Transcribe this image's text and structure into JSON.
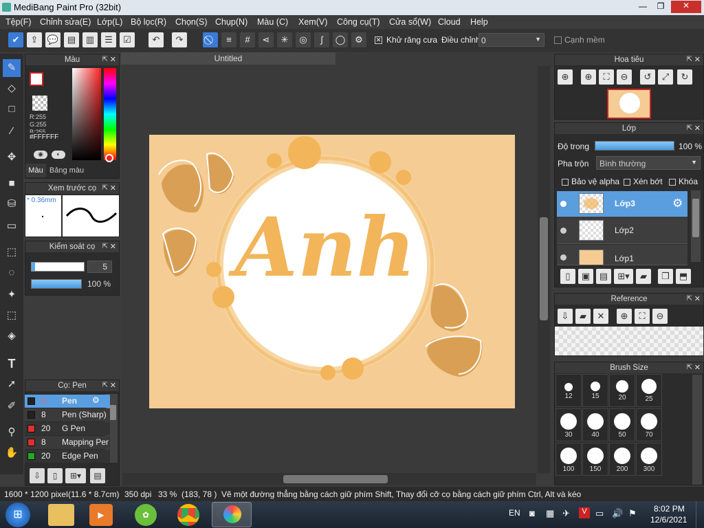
{
  "window": {
    "title": "MediBang Paint Pro (32bit)"
  },
  "menu": [
    "Tệp(F)",
    "Chỉnh sửa(E)",
    "Lớp(L)",
    "Bộ lọc(R)",
    "Chọn(S)",
    "Chụp(N)",
    "Màu (C)",
    "Xem(V)",
    "Công cụ(T)",
    "Cửa sổ(W)",
    "Cloud",
    "Help"
  ],
  "toolbar": {
    "antialias_label": "Khử răng cưa",
    "adjust_label": "Điều chỉnh",
    "adjust_value": "0",
    "soft_edge_label": "Cạnh mềm"
  },
  "color_panel": {
    "title": "Màu",
    "r": "R:255",
    "g": "G:255",
    "b": "B:255",
    "hex": "#FFFFFF",
    "tab_color": "Màu",
    "tab_palette": "Bảng màu"
  },
  "preview_panel": {
    "title": "Xem trước cọ",
    "size": "0.36mm"
  },
  "control_panel": {
    "title": "Kiểm soát cọ",
    "size_value": "5",
    "opacity_value": "100 %"
  },
  "brush_panel": {
    "title": "Cọ: Pen",
    "items": [
      {
        "size": "5",
        "name": "Pen",
        "color": "#222222"
      },
      {
        "size": "8",
        "name": "Pen (Sharp)",
        "color": "#222222"
      },
      {
        "size": "20",
        "name": "G Pen",
        "color": "#e03030"
      },
      {
        "size": "8",
        "name": "Mapping Pen",
        "color": "#e03030"
      },
      {
        "size": "20",
        "name": "Edge Pen",
        "color": "#22aa22"
      }
    ]
  },
  "document": {
    "tab": "Untitled",
    "art_text": "Anh"
  },
  "navigator": {
    "title": "Hoa tiêu"
  },
  "layer_panel": {
    "title": "Lớp",
    "opacity_label": "Độ trong",
    "opacity_value": "100 %",
    "blend_label": "Pha trộn",
    "blend_value": "Bình thường",
    "protect_alpha": "Bảo vệ alpha",
    "clipping": "Xén bớt",
    "lock": "Khóa",
    "layers": [
      "Lớp3",
      "Lớp2",
      "Lớp1"
    ]
  },
  "reference_panel": {
    "title": "Reference"
  },
  "brush_size_panel": {
    "title": "Brush Size",
    "sizes": [
      "12",
      "15",
      "20",
      "25",
      "30",
      "40",
      "50",
      "70",
      "100",
      "150",
      "200",
      "300"
    ]
  },
  "status": {
    "dims": "1600 * 1200 pixel",
    "physical": "(11.6 * 8.7cm)",
    "dpi": "350 dpi",
    "zoom": "33 %",
    "coords": "(183, 78 )",
    "hint": "Vẽ một đường thẳng bằng cách giữ phím Shift, Thay đổi cỡ cọ bằng cách giữ phím Ctrl, Alt và kéo"
  },
  "taskbar": {
    "lang": "EN",
    "time": "8:02 PM",
    "date": "12/6/2021"
  },
  "colors": {
    "accent": "#3a7bd5",
    "canvas_bg": "#f4cc94",
    "art_orange": "#f2b55a",
    "art_brown": "#d9a055"
  }
}
